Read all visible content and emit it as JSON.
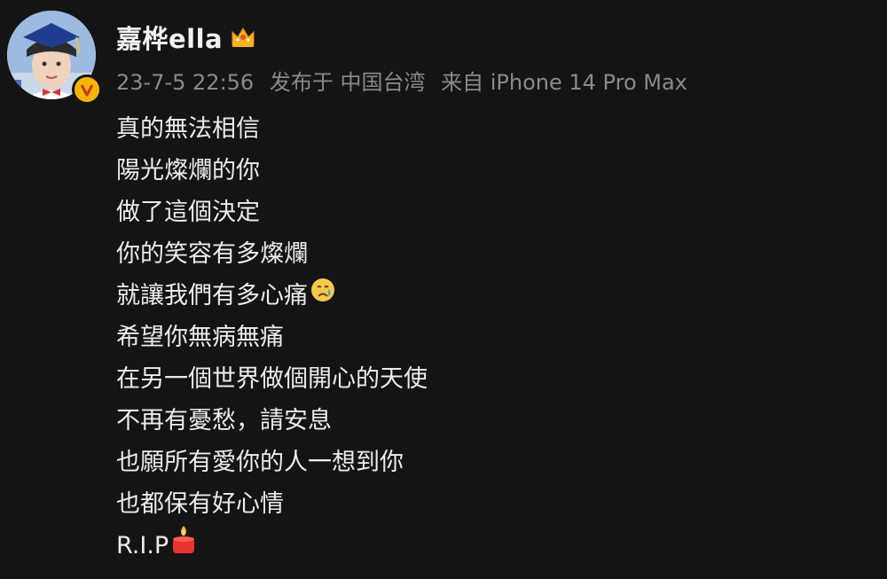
{
  "post": {
    "username": "嘉桦ella",
    "timestamp": "23-7-5 22:56",
    "location": "发布于 中国台湾",
    "device": "来自 iPhone 14 Pro Max",
    "badge_icon": "verified-v-icon",
    "crown_icon": "crown-icon",
    "lines": [
      "真的無法相信",
      "陽光燦爛的你",
      "做了這個決定",
      "你的笑容有多燦爛",
      "就讓我們有多心痛",
      "希望你無病無痛",
      "在另一個世界做個開心的天使",
      "不再有憂愁，請安息",
      "也願所有愛你的人一想到你",
      "也都保有好心情",
      "R.I.P"
    ],
    "emojis": {
      "line_5": "crying-face-icon",
      "line_11": "candle-icon"
    },
    "colors": {
      "background": "#141414",
      "text": "#ececec",
      "meta": "#8a8a8a",
      "badge": "#f7b500"
    }
  }
}
